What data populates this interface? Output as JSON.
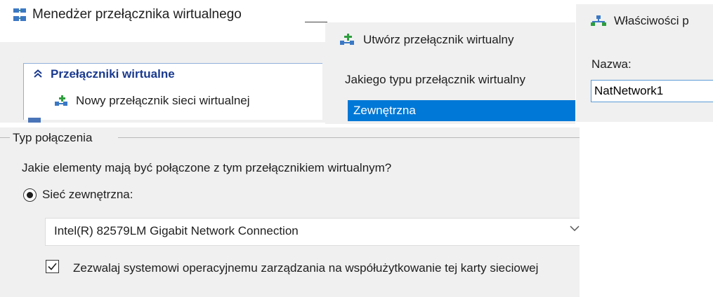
{
  "manager": {
    "title": "Menedżer przełącznika wirtualnego",
    "section_header": "Przełączniki wirtualne",
    "new_switch": "Nowy przełącznik sieci wirtualnej"
  },
  "create": {
    "title": "Utwórz przełącznik wirtualny",
    "question": "Jakiego typu przełącznik wirtualny",
    "selected_type": "Zewnętrzna"
  },
  "properties": {
    "title": "Właściwości p",
    "name_label": "Nazwa:",
    "name_value": "NatNetwork1"
  },
  "connection": {
    "group_label": "Typ połączenia",
    "question": "Jakie elementy mają być połączone z tym przełącznikiem wirtualnym?",
    "external_label": "Sieć zewnętrzna:",
    "external_selected": true,
    "adapter": "Intel(R) 82579LM Gigabit Network Connection",
    "allow_mgmt_label": "Zezwalaj systemowi operacyjnemu zarządzania na współużytkowanie tej karty sieciowej",
    "allow_mgmt_checked": true
  },
  "icons": {
    "manager": "switch-manager-icon",
    "add_switch": "add-switch-icon",
    "network": "network-icon",
    "collapse": "collapse-chevron-icon",
    "dropdown": "chevron-down-icon"
  },
  "colors": {
    "selection": "#0078d7",
    "header_text": "#1a3a8f",
    "panel_bg": "#f0f0f0"
  }
}
